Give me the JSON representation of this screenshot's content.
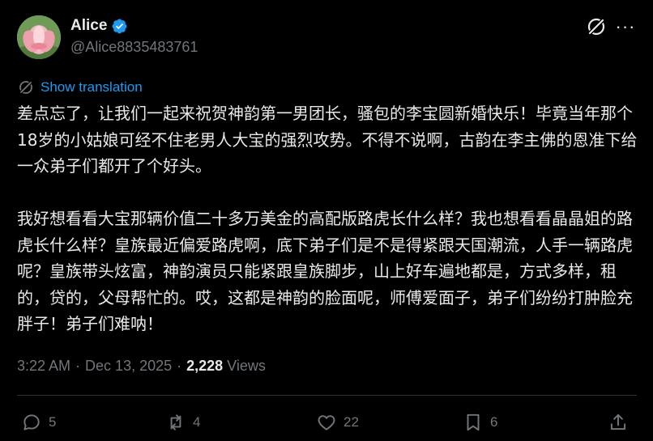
{
  "author": {
    "display_name": "Alice",
    "handle": "@Alice8835483761",
    "verified": true,
    "verified_color": "#1d9bf0",
    "avatar_icon": "lotus-flower-avatar"
  },
  "header_actions": {
    "grok_icon": "grok-icon",
    "more_label": "···"
  },
  "translate": {
    "label": "Show translation",
    "icon": "translate-icon"
  },
  "post": {
    "paragraphs": [
      "差点忘了，让我们一起来祝贺神韵第一男团长，骚包的李宝圆新婚快乐！毕竟当年那个18岁的小姑娘可经不住老男人大宝的强烈攻势。不得不说啊，古韵在李主佛的恩准下给一众弟子们都开了个好头。",
      "我好想看看大宝那辆价值二十多万美金的高配版路虎长什么样？我也想看看晶晶姐的路虎长什么样？皇族最近偏爱路虎啊，底下弟子们是不是得紧跟天国潮流，人手一辆路虎呢？皇族带头炫富，神韵演员只能紧跟皇族脚步，山上好车遍地都是，方式多样，租的，贷的，父母帮忙的。哎，这都是神韵的脸面呢，师傅爱面子，弟子们纷纷打肿脸充胖子！弟子们难呐！"
    ]
  },
  "meta": {
    "time": "3:22 AM",
    "separator": "·",
    "date": "Dec 13, 2025",
    "views_count": "2,228",
    "views_label": "Views"
  },
  "actions": {
    "reply_count": "5",
    "repost_count": "4",
    "like_count": "22",
    "bookmark_count": "6"
  },
  "colors": {
    "background": "#000000",
    "text": "#e7e9ea",
    "secondary": "#71767b",
    "accent": "#1d9bf0",
    "divider": "#2f3336"
  }
}
